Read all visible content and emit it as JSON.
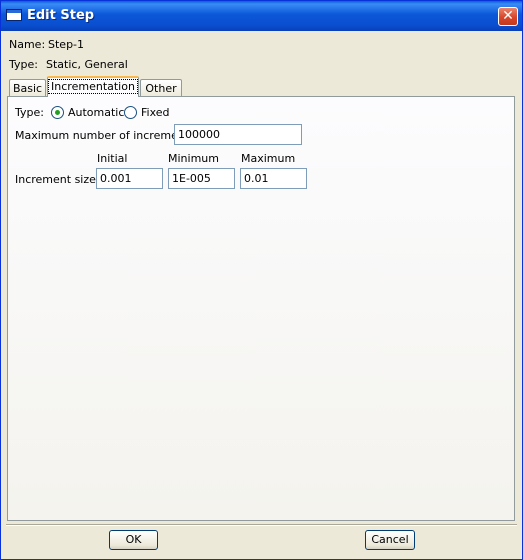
{
  "window": {
    "title": "Edit Step",
    "close_label": "✕"
  },
  "info": {
    "name_label": "Name:",
    "name_value": "Step-1",
    "type_label": "Type:",
    "type_value": "Static, General"
  },
  "tabs": [
    {
      "label": "Basic"
    },
    {
      "label": "Incrementation"
    },
    {
      "label": "Other"
    }
  ],
  "incrementation": {
    "type_label": "Type:",
    "type_options": [
      {
        "label": "Automatic",
        "selected": true
      },
      {
        "label": "Fixed",
        "selected": false
      }
    ],
    "max_increments_label": "Maximum number of increments:",
    "max_increments_value": "100000",
    "columns": [
      "Initial",
      "Minimum",
      "Maximum"
    ],
    "increment_size_label": "Increment size:",
    "increment_size_values": [
      "0.001",
      "1E-005",
      "0.01"
    ]
  },
  "buttons": {
    "ok": "OK",
    "cancel": "Cancel"
  },
  "colors": {
    "titlebar": "#0a55d5",
    "dialog_bg": "#ece9d8",
    "radio_selected": "#21a121",
    "active_tab_accent": "#f9b84d"
  }
}
